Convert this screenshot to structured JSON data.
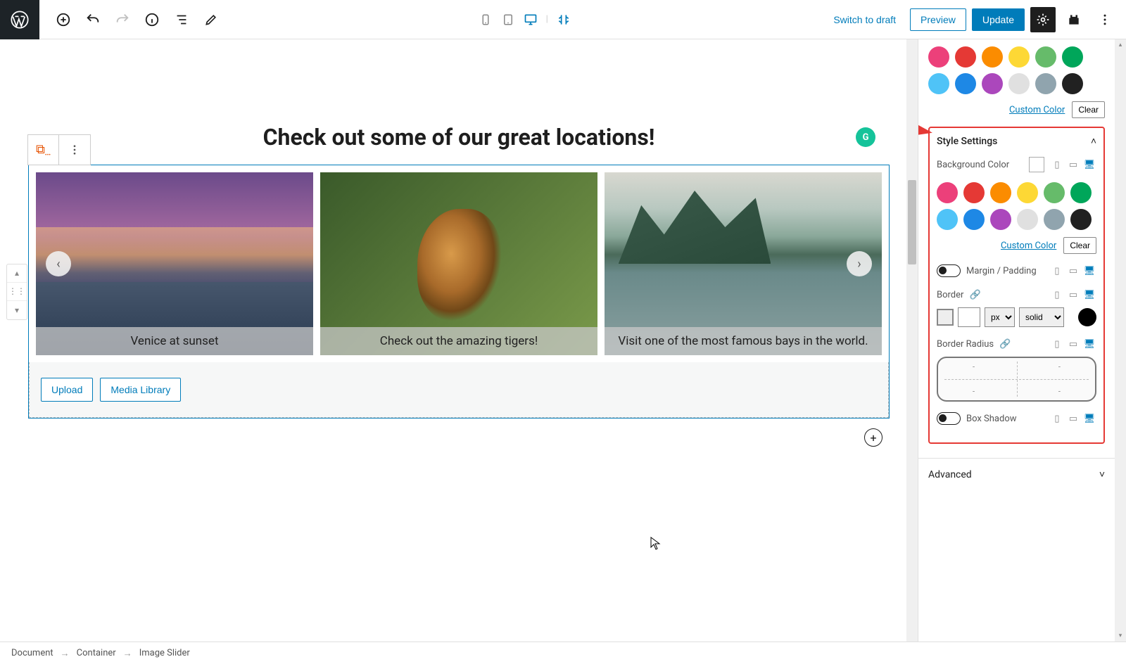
{
  "toolbar": {
    "switch_draft": "Switch to draft",
    "preview": "Preview",
    "update": "Update"
  },
  "content": {
    "heading": "Check out some of our great locations!",
    "slides": [
      {
        "caption": "Venice at sunset"
      },
      {
        "caption": "Check out the amazing tigers!"
      },
      {
        "caption": "Visit one of the most famous bays in the world."
      }
    ],
    "upload": "Upload",
    "media_library": "Media Library"
  },
  "sidebar": {
    "custom_color": "Custom Color",
    "clear": "Clear",
    "style_settings": "Style Settings",
    "background_color": "Background Color",
    "margin_padding": "Margin / Padding",
    "border": "Border",
    "border_unit": "px",
    "border_style": "solid",
    "border_radius": "Border Radius",
    "radius_placeholder": "-",
    "box_shadow": "Box Shadow",
    "advanced": "Advanced",
    "palette": [
      "#ec407a",
      "#e53935",
      "#fb8c00",
      "#fdd835",
      "#66bb6a",
      "#00a65a",
      "#4fc3f7",
      "#1e88e5",
      "#ab47bc",
      "#e0e0e0",
      "#90a4ae",
      "#212121"
    ]
  },
  "breadcrumb": {
    "a": "Document",
    "b": "Container",
    "c": "Image Slider"
  }
}
